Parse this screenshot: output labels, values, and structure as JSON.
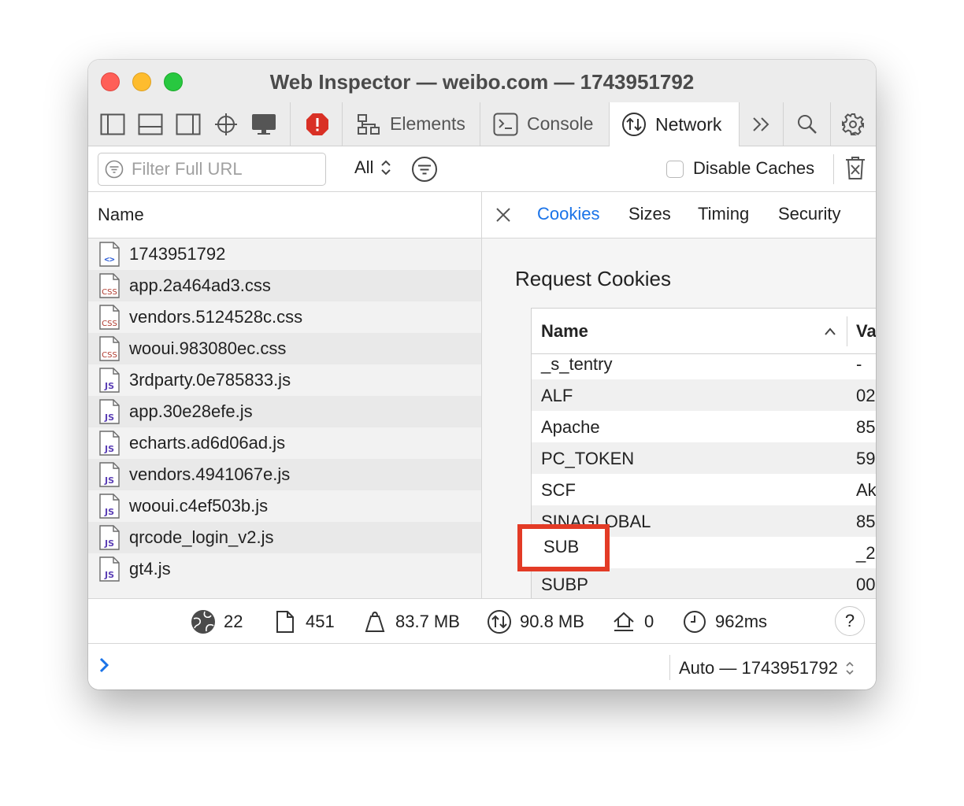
{
  "window": {
    "title": "Web Inspector — weibo.com — 1743951792"
  },
  "tabs": [
    {
      "label": "Elements",
      "icon": "elements-icon"
    },
    {
      "label": "Console",
      "icon": "console-icon"
    },
    {
      "label": "Network",
      "icon": "network-icon",
      "selected": true
    }
  ],
  "toolbar": {
    "filter_placeholder": "Filter Full URL",
    "filter_value": "",
    "resource_type": "All",
    "disable_caches_label": "Disable Caches",
    "disable_caches_checked": false
  },
  "requests": {
    "column_header": "Name",
    "items": [
      {
        "name": "1743951792",
        "type": "html"
      },
      {
        "name": "app.2a464ad3.css",
        "type": "css"
      },
      {
        "name": "vendors.5124528c.css",
        "type": "css"
      },
      {
        "name": "wooui.983080ec.css",
        "type": "css"
      },
      {
        "name": "3rdparty.0e785833.js",
        "type": "js"
      },
      {
        "name": "app.30e28efe.js",
        "type": "js"
      },
      {
        "name": "echarts.ad6d06ad.js",
        "type": "js"
      },
      {
        "name": "vendors.4941067e.js",
        "type": "js"
      },
      {
        "name": "wooui.c4ef503b.js",
        "type": "js"
      },
      {
        "name": "qrcode_login_v2.js",
        "type": "js"
      },
      {
        "name": "gt4.js",
        "type": "js"
      }
    ]
  },
  "detail": {
    "tabs": [
      "Cookies",
      "Sizes",
      "Timing",
      "Security"
    ],
    "active_tab": "Cookies",
    "section_title": "Request Cookies",
    "table": {
      "name_header": "Name",
      "value_header": "Va",
      "rows": [
        {
          "name": "_s_tentry",
          "value": "-"
        },
        {
          "name": "ALF",
          "value": "02"
        },
        {
          "name": "Apache",
          "value": "85"
        },
        {
          "name": "PC_TOKEN",
          "value": "59"
        },
        {
          "name": "SCF",
          "value": "Ak"
        },
        {
          "name": "SINAGLOBAL",
          "value": "85"
        },
        {
          "name": "SUB",
          "value": "_2"
        },
        {
          "name": "SUBP",
          "value": "00"
        }
      ],
      "highlighted": "SUB"
    }
  },
  "status": {
    "domains": "22",
    "requests": "451",
    "resources_size": "83.7 MB",
    "transferred": "90.8 MB",
    "redirects": "0",
    "time": "962ms",
    "help_label": "?"
  },
  "console_bar": {
    "context": "Auto — 1743951792"
  },
  "colors": {
    "accent": "#1a73e8",
    "highlight": "#e33b26",
    "error": "#d93025"
  }
}
